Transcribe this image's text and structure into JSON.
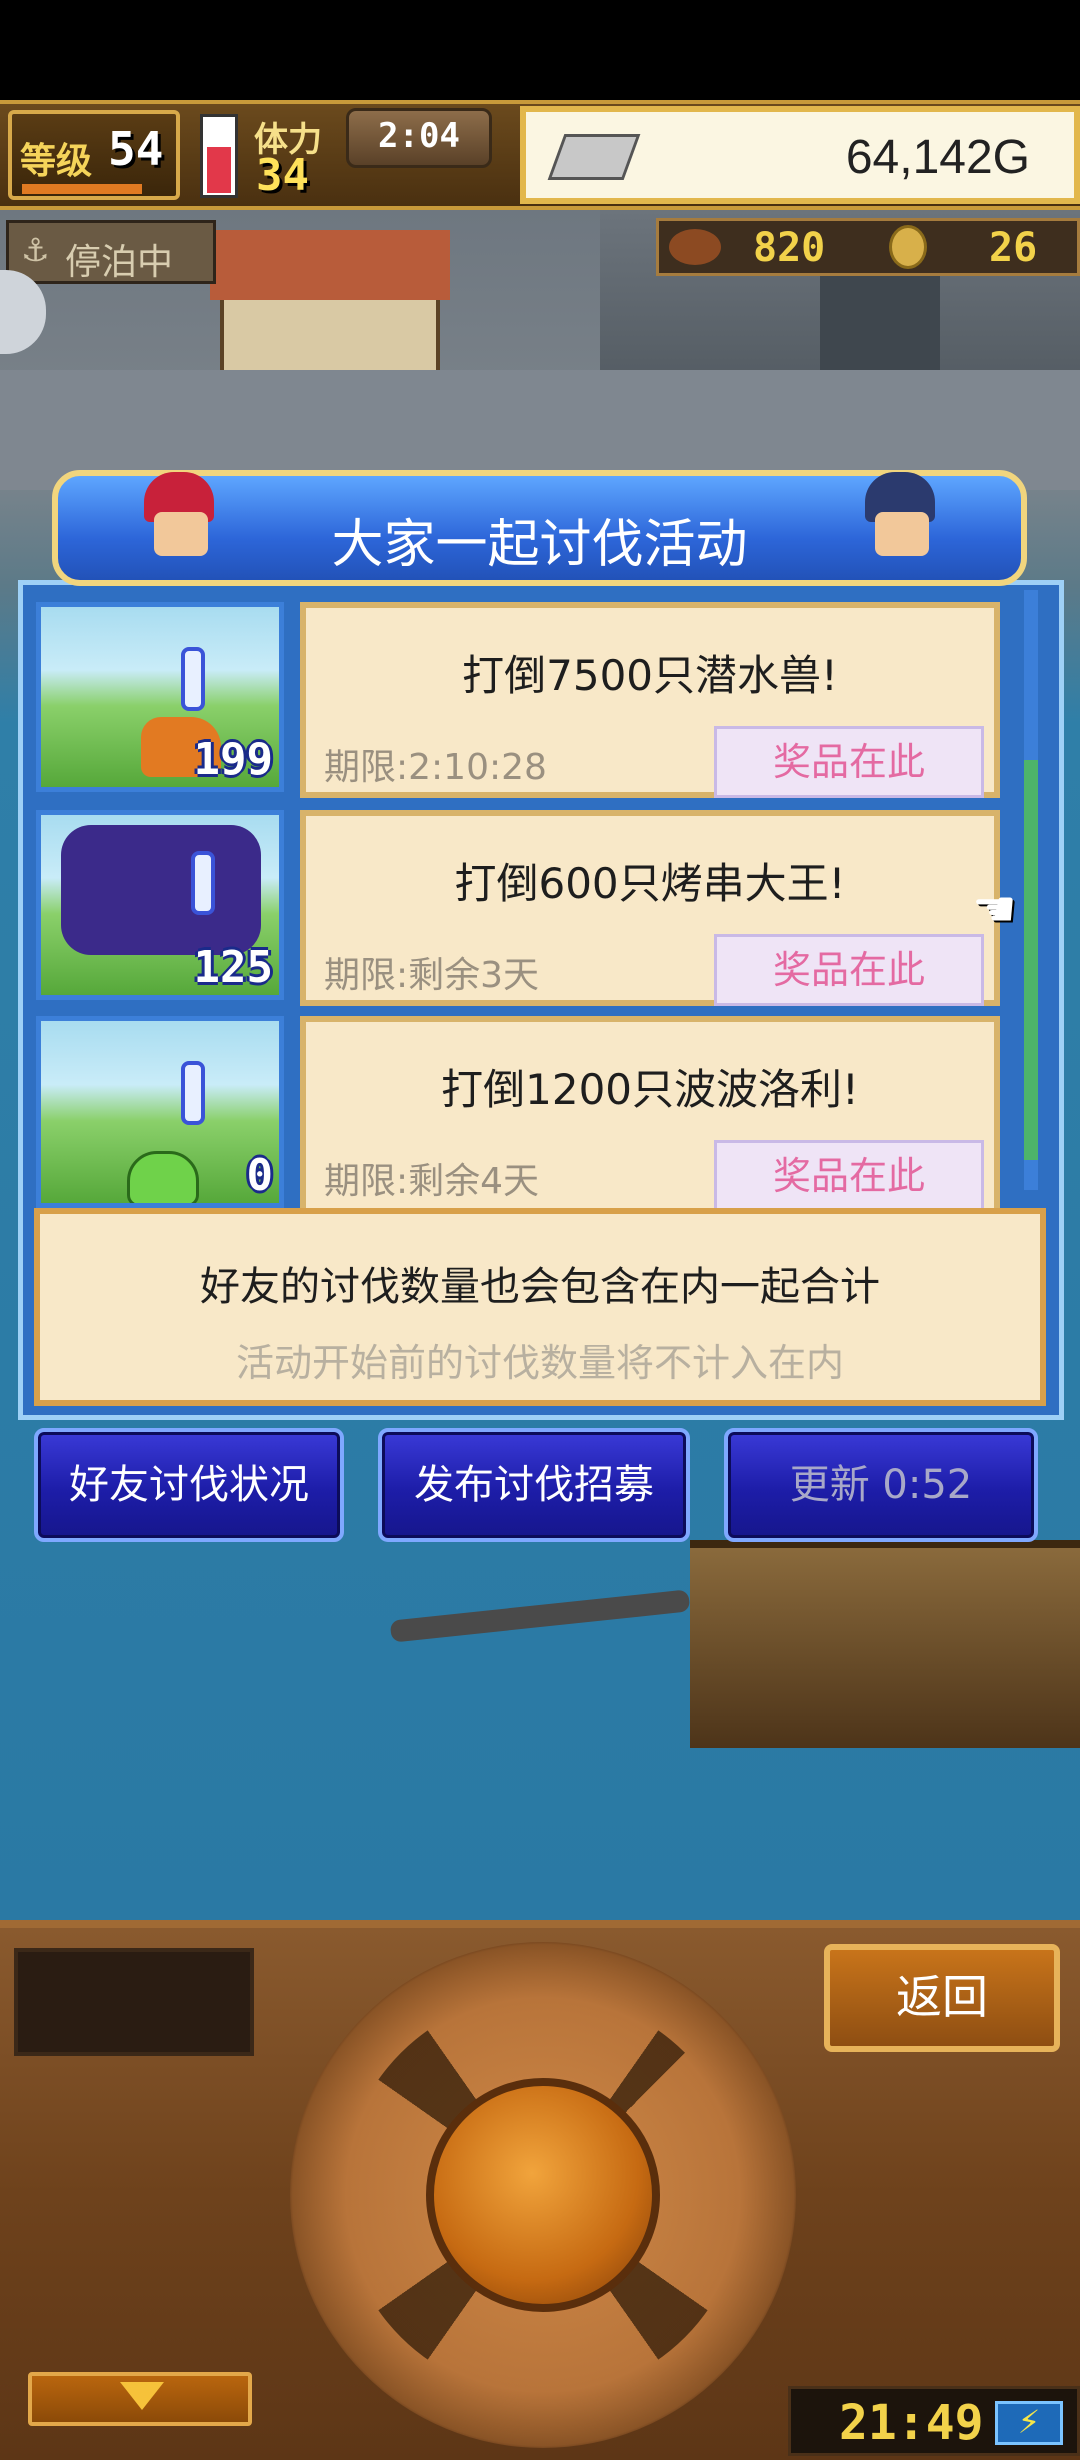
{
  "status": {
    "level_label": "等级",
    "level_value": "54",
    "stamina_label": "体力",
    "stamina_value": "34",
    "stamina_timer": "2:04",
    "gold": "64,142G",
    "docked_label": "停泊中",
    "food_value": "820",
    "medal_value": "26"
  },
  "dialog": {
    "title": "大家一起讨伐活动",
    "rows": [
      {
        "title": "打倒7500只潜水兽!",
        "limit": "期限:2:10:28",
        "prize": "奖品在此",
        "count": "199"
      },
      {
        "title": "打倒600只烤串大王!",
        "limit": "期限:剩余3天",
        "prize": "奖品在此",
        "count": "125"
      },
      {
        "title": "打倒1200只波波洛利!",
        "limit": "期限:剩余4天",
        "prize": "奖品在此",
        "count": "0"
      }
    ],
    "note_main": "好友的讨伐数量也会包含在内一起合计",
    "note_sub": "活动开始前的讨伐数量将不计入在内",
    "buttons": {
      "friends_status": "好友讨伐状况",
      "post_recruit": "发布讨伐招募",
      "refresh": "更新 0:52"
    }
  },
  "console": {
    "back": "返回",
    "clock": "21:49"
  },
  "colors": {
    "dialog_blue": "#2f6fc2",
    "card_bg": "#f8e8c8",
    "prize_text": "#e46aa2",
    "button_blue": "#1d1da8"
  }
}
